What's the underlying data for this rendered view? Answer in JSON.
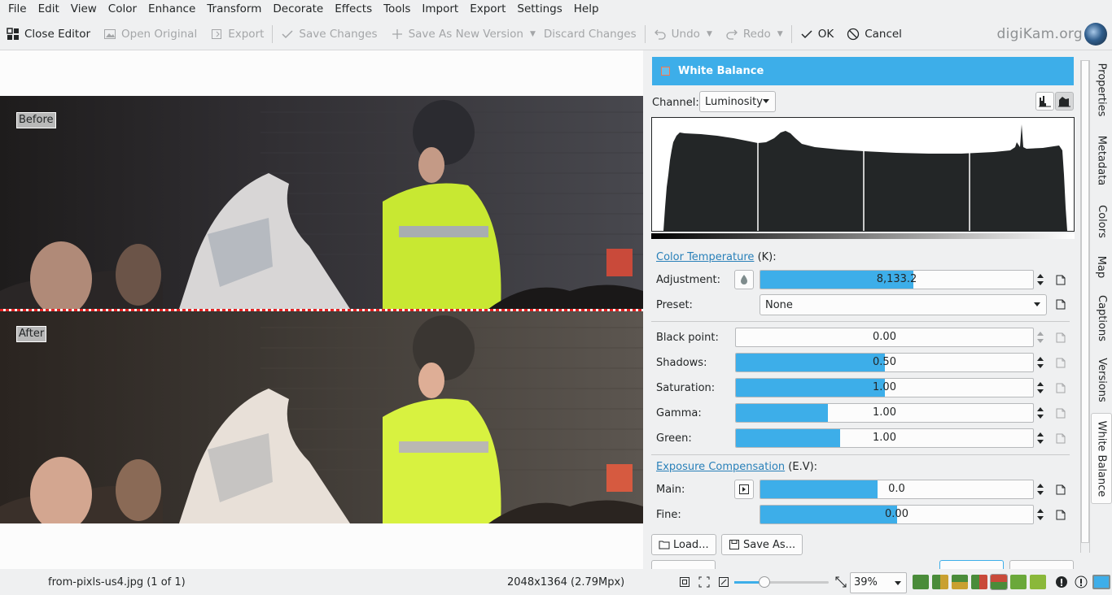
{
  "menu": [
    "File",
    "Edit",
    "View",
    "Color",
    "Enhance",
    "Transform",
    "Decorate",
    "Effects",
    "Tools",
    "Import",
    "Export",
    "Settings",
    "Help"
  ],
  "toolbar": {
    "close_editor": "Close Editor",
    "open_original": "Open Original",
    "export": "Export",
    "save_changes": "Save Changes",
    "save_as_new_version": "Save As New Version",
    "discard_changes": "Discard Changes",
    "undo": "Undo",
    "redo": "Redo",
    "ok": "OK",
    "cancel": "Cancel"
  },
  "brand": "digiKam.org",
  "preview": {
    "before_label": "Before",
    "after_label": "After"
  },
  "panel": {
    "title": "White Balance",
    "channel_label": "Channel:",
    "channel_value": "Luminosity",
    "color_temperature_link": "Color Temperature",
    "color_temperature_unit": "(K):",
    "adjustment_label": "Adjustment:",
    "adjustment_value": "8,133.2",
    "adjustment_fraction": 0.56,
    "preset_label": "Preset:",
    "preset_value": "None",
    "black_point_label": "Black point:",
    "black_point_value": "0.00",
    "black_point_fraction": 0.0,
    "shadows_label": "Shadows:",
    "shadows_value": "0.50",
    "shadows_fraction": 0.5,
    "saturation_label": "Saturation:",
    "saturation_value": "1.00",
    "saturation_fraction": 0.5,
    "gamma_label": "Gamma:",
    "gamma_value": "1.00",
    "gamma_fraction": 0.31,
    "green_label": "Green:",
    "green_value": "1.00",
    "green_fraction": 0.35,
    "exposure_link": "Exposure Compensation",
    "exposure_unit": "(E.V):",
    "main_label": "Main:",
    "main_value": "0.0",
    "main_fraction": 0.43,
    "fine_label": "Fine:",
    "fine_value": "0.00",
    "fine_fraction": 0.5,
    "load_button": "Load...",
    "save_as_button": "Save As..."
  },
  "sidebar_tabs": [
    "Properties",
    "Metadata",
    "Colors",
    "Map",
    "Captions",
    "Versions",
    "White Balance"
  ],
  "status": {
    "filename": "from-pixls-us4.jpg (1 of 1)",
    "dimensions": "2048x1364 (2.79Mpx)",
    "zoom": "39%",
    "zoom_fraction": 0.31
  },
  "colors": {
    "accent": "#3daee9",
    "window_bg": "#eff0f1",
    "split_line": "#e02020"
  }
}
